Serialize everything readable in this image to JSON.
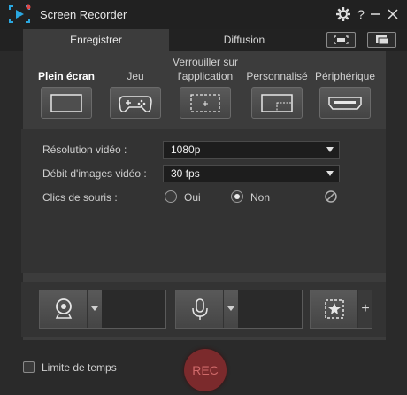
{
  "app": {
    "title": "Screen Recorder"
  },
  "titlebar": {
    "settings_icon": "gear-icon",
    "help_label": "?",
    "minimize_icon": "minimize-icon",
    "close_icon": "close-icon"
  },
  "tabs": [
    {
      "label": "Enregistrer",
      "active": true
    },
    {
      "label": "Diffusion",
      "active": false
    }
  ],
  "modes": [
    {
      "label": "Plein écran",
      "selected": true,
      "icon": "fullscreen-icon"
    },
    {
      "label": "Jeu",
      "selected": false,
      "icon": "gamepad-icon"
    },
    {
      "label": "Verrouiller sur l'application",
      "label_line1": "Verrouiller sur",
      "label_line2": "l'application",
      "selected": false,
      "icon": "lock-app-icon"
    },
    {
      "label": "Personnalisé",
      "selected": false,
      "icon": "custom-area-icon"
    },
    {
      "label": "Périphérique",
      "selected": false,
      "icon": "hdmi-device-icon"
    }
  ],
  "settings": {
    "resolution_label": "Résolution vidéo :",
    "resolution_value": "1080p",
    "framerate_label": "Débit d'images vidéo :",
    "framerate_value": "30 fps",
    "mouse_clicks_label": "Clics de souris :",
    "mouse_options": [
      {
        "label": "Oui",
        "checked": false
      },
      {
        "label": "Non",
        "checked": true
      }
    ]
  },
  "devices": {
    "webcam_icon": "webcam-icon",
    "mic_icon": "microphone-icon",
    "effects_icon": "effects-icon",
    "add_label": "+"
  },
  "bottom": {
    "time_limit_label": "Limite de temps",
    "time_limit_checked": false,
    "rec_label": "REC"
  },
  "colors": {
    "background": "#2a2a2a",
    "panel": "#3c3c3c",
    "accent_logo": "#2aa7e0",
    "rec": "#7b2a2c"
  }
}
